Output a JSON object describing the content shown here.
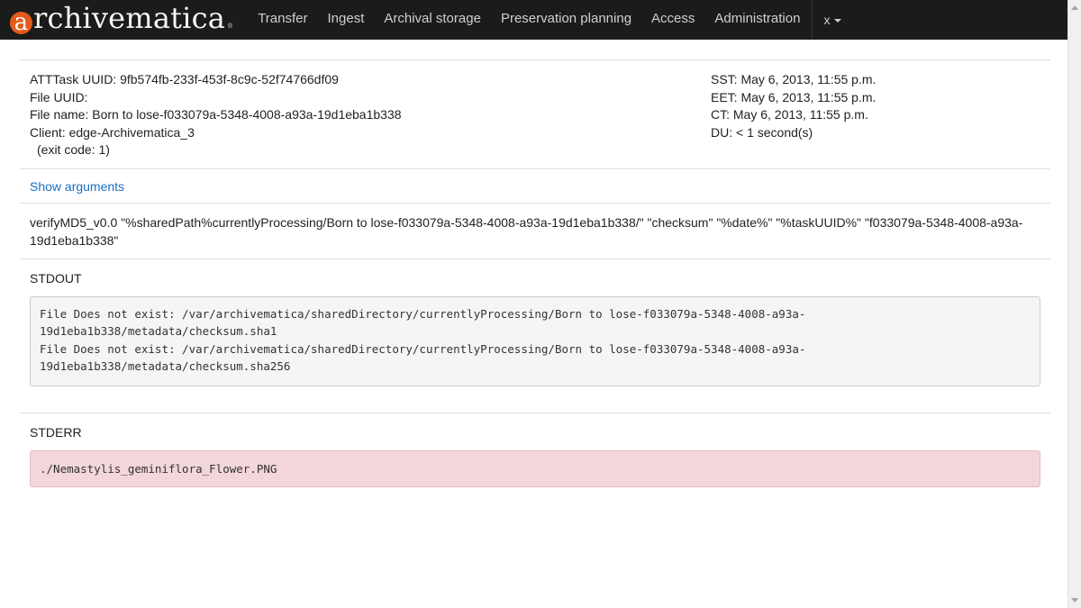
{
  "nav": {
    "logo_letter": "a",
    "logo_rest": "rchivematica",
    "logo_reg": "®",
    "items": [
      "Transfer",
      "Ingest",
      "Archival storage",
      "Preservation planning",
      "Access",
      "Administration"
    ],
    "user": "x"
  },
  "task": {
    "uuid_line": "ATTTask UUID: 9fb574fb-233f-453f-8c9c-52f74766df09",
    "file_uuid_line": "File UUID:",
    "file_name_line": "File name: Born to lose-f033079a-5348-4008-a93a-19d1eba1b338",
    "client_line": "Client: edge-Archivematica_3",
    "exit_code_line": "(exit code: 1)",
    "sst_line": "SST: May 6, 2013, 11:55 p.m.",
    "eet_line": "EET: May 6, 2013, 11:55 p.m.",
    "ct_line": "CT: May 6, 2013, 11:55 p.m.",
    "du_line": "DU: < 1 second(s)"
  },
  "arguments": {
    "toggle_label": "Show arguments",
    "command": "verifyMD5_v0.0 \"%sharedPath%currentlyProcessing/Born to lose-f033079a-5348-4008-a93a-19d1eba1b338/\" \"checksum\" \"%date%\" \"%taskUUID%\" \"f033079a-5348-4008-a93a-19d1eba1b338\""
  },
  "stdout": {
    "heading": "STDOUT",
    "text": "File Does not exist: /var/archivematica/sharedDirectory/currentlyProcessing/Born to lose-f033079a-5348-4008-a93a-19d1eba1b338/metadata/checksum.sha1\nFile Does not exist: /var/archivematica/sharedDirectory/currentlyProcessing/Born to lose-f033079a-5348-4008-a93a-19d1eba1b338/metadata/checksum.sha256"
  },
  "stderr": {
    "heading": "STDERR",
    "text": "./Nemastylis_geminiflora_Flower.PNG"
  },
  "colors": {
    "navbar_bg": "#1b1b1b",
    "logo_accent": "#e55a1a",
    "link": "#1a6fc4",
    "stderr_bg": "#f2d6d9"
  }
}
